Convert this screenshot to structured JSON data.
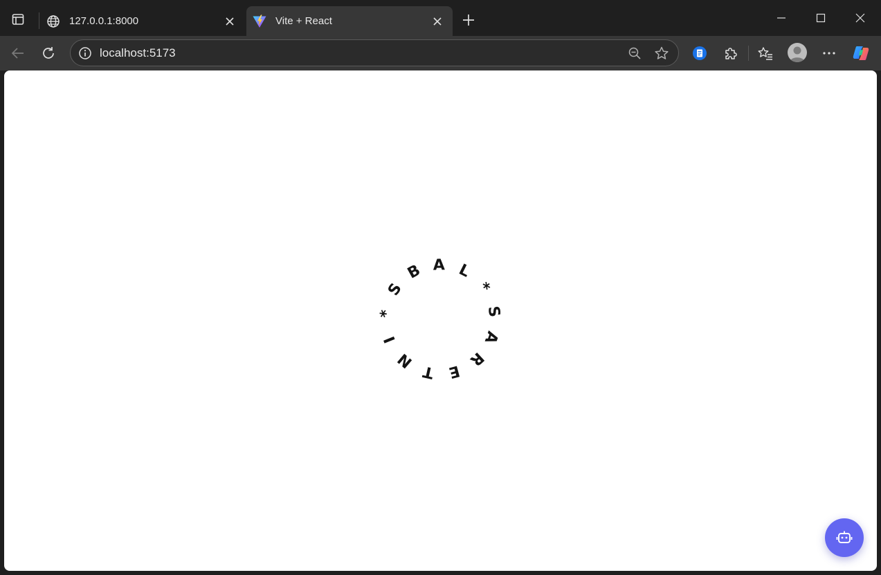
{
  "tabs": [
    {
      "title": "127.0.0.1:8000",
      "favicon": "globe-icon",
      "active": false
    },
    {
      "title": "Vite + React",
      "favicon": "vite-logo-icon",
      "active": true
    }
  ],
  "address_bar": {
    "url": "localhost:5173"
  },
  "page": {
    "badge_letters": [
      "I",
      "N",
      "T",
      "E",
      "R",
      "A",
      "S",
      "*",
      "L",
      "A",
      "B",
      "S",
      "*"
    ],
    "accent_color": "#6366f1"
  },
  "colors": {
    "chrome_dark": "#1f1f1f",
    "toolbar": "#373737",
    "page_bg": "#ffffff",
    "fab": "#6366f1"
  }
}
